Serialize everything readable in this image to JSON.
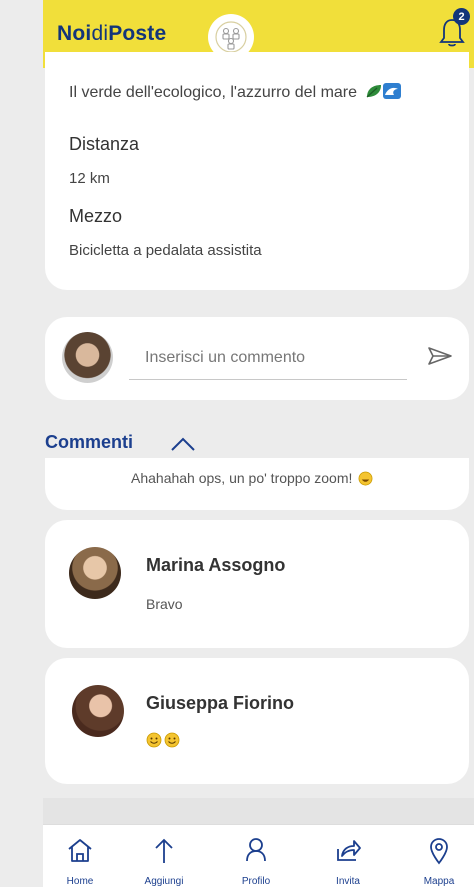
{
  "header": {
    "brand_bold_1": "Noi",
    "brand_light": "di",
    "brand_bold_2": "Poste",
    "notification_count": "2"
  },
  "details": {
    "tagline": "Il verde dell'ecologico, l'azzurro del mare",
    "distance_label": "Distanza",
    "distance_value": "12 km",
    "vehicle_label": "Mezzo",
    "vehicle_value": "Bicicletta a pedalata assistita"
  },
  "comment_input": {
    "placeholder": "Inserisci un commento"
  },
  "comments": {
    "section_label": "Commenti",
    "partial_text": "Ahahahah ops, un po' troppo zoom!",
    "items": [
      {
        "author": "Marina Assogno",
        "text": "Bravo"
      },
      {
        "author": "Giuseppa Fiorino",
        "text": ""
      }
    ]
  },
  "bottom_nav": {
    "items": [
      {
        "label": "Home",
        "icon": "home-icon"
      },
      {
        "label": "Aggiungi",
        "icon": "arrow-up-icon"
      },
      {
        "label": "Profilo",
        "icon": "user-icon"
      },
      {
        "label": "Invita",
        "icon": "share-icon"
      },
      {
        "label": "Mappa",
        "icon": "map-pin-icon"
      }
    ]
  },
  "colors": {
    "header_bg": "#f1df3a",
    "brand_blue": "#13357a",
    "accent_blue": "#1c3f8e"
  }
}
